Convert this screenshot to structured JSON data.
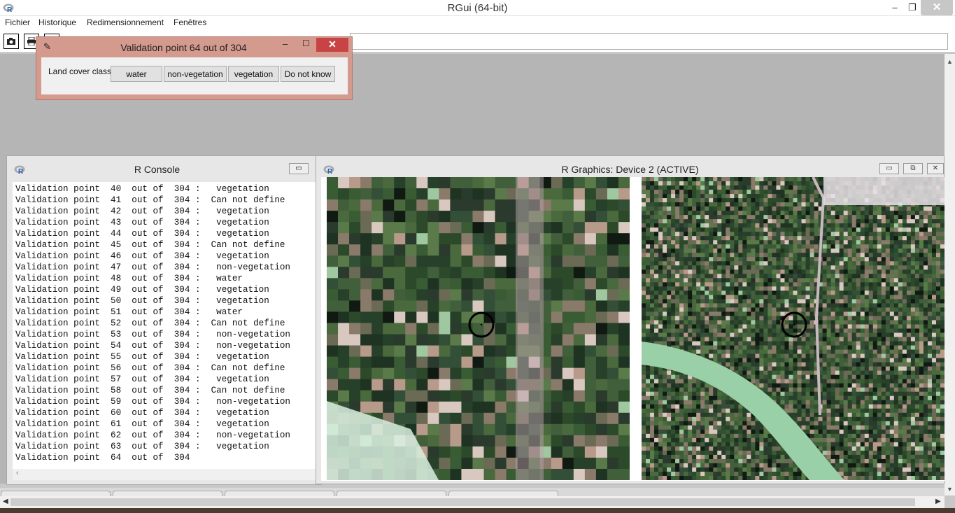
{
  "window": {
    "title": "RGui (64-bit)",
    "minimize": "–",
    "maximize": "❐",
    "close": "✕"
  },
  "menu": [
    "Fichier",
    "Historique",
    "Redimensionnement",
    "Fenêtres"
  ],
  "dialog": {
    "title": "Validation point  64  out of  304",
    "label": "Land cover class",
    "buttons": [
      "water",
      "non-vegetation",
      "vegetation",
      "Do not know"
    ],
    "minimize": "–",
    "maximize": "☐",
    "close": "✕"
  },
  "console": {
    "title": "R Console",
    "lines": [
      "Validation point  40  out of  304 :   vegetation",
      "Validation point  41  out of  304 :  Can not define",
      "Validation point  42  out of  304 :   vegetation",
      "Validation point  43  out of  304 :   vegetation",
      "Validation point  44  out of  304 :   vegetation",
      "Validation point  45  out of  304 :  Can not define",
      "Validation point  46  out of  304 :   vegetation",
      "Validation point  47  out of  304 :   non-vegetation",
      "Validation point  48  out of  304 :   water",
      "Validation point  49  out of  304 :   vegetation",
      "Validation point  50  out of  304 :   vegetation",
      "Validation point  51  out of  304 :   water",
      "Validation point  52  out of  304 :  Can not define",
      "Validation point  53  out of  304 :   non-vegetation",
      "Validation point  54  out of  304 :   non-vegetation",
      "Validation point  55  out of  304 :   vegetation",
      "Validation point  56  out of  304 :  Can not define",
      "Validation point  57  out of  304 :   vegetation",
      "Validation point  58  out of  304 :  Can not define",
      "Validation point  59  out of  304 :   non-vegetation",
      "Validation point  60  out of  304 :   vegetation",
      "Validation point  61  out of  304 :   vegetation",
      "Validation point  62  out of  304 :   non-vegetation",
      "Validation point  63  out of  304 :   vegetation",
      "Validation point  64  out of  304"
    ]
  },
  "graphics": {
    "title": "R Graphics: Device 2 (ACTIVE)"
  },
  "icons": {
    "app": "r-logo-icon",
    "camera": "camera-icon",
    "print": "print-icon",
    "dialog": "feather-icon"
  }
}
